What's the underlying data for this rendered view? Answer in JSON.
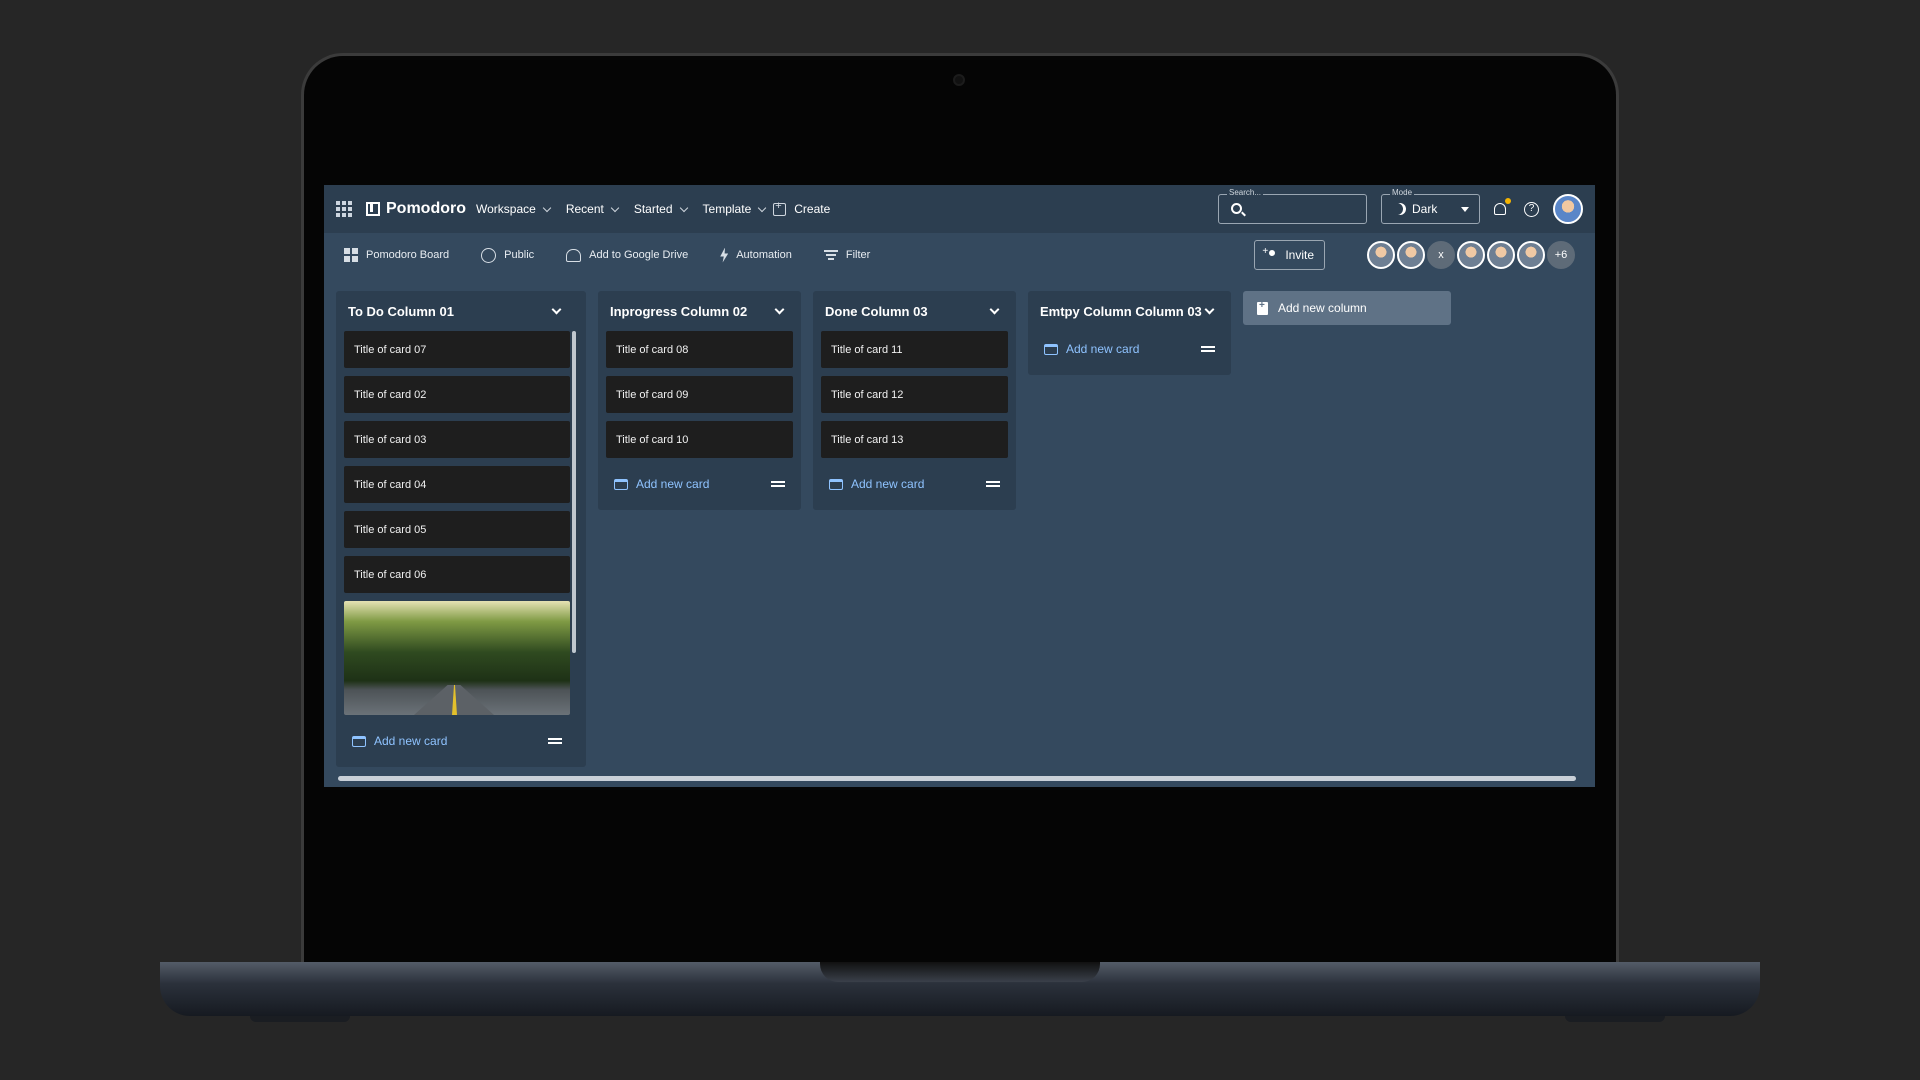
{
  "app": {
    "brand": "Pomodoro",
    "nav": [
      {
        "label": "Workspace"
      },
      {
        "label": "Recent"
      },
      {
        "label": "Started"
      },
      {
        "label": "Template"
      }
    ],
    "create_label": "Create",
    "search_label": "Search...",
    "search_value": "",
    "mode_label": "Mode",
    "mode_value": "Dark"
  },
  "toolbar": {
    "board_label": "Pomodoro Board",
    "public_label": "Public",
    "drive_label": "Add to Google Drive",
    "automation_label": "Automation",
    "filter_label": "Filter",
    "invite_label": "Invite",
    "member_letter": "x",
    "members_more": "+6"
  },
  "columns": [
    {
      "title": "To Do Column 01",
      "cards": [
        "Title of card 07",
        "Title of card 02",
        "Title of card 03",
        "Title of card 04",
        "Title of card 05",
        "Title of card 06"
      ],
      "add_label": "Add new card"
    },
    {
      "title": "Inprogress Column 02",
      "cards": [
        "Title of card 08",
        "Title of card 09",
        "Title of card 10"
      ],
      "add_label": "Add new card"
    },
    {
      "title": "Done Column 03",
      "cards": [
        "Title of card 11",
        "Title of card 12",
        "Title of card 13"
      ],
      "add_label": "Add new card"
    },
    {
      "title": "Emtpy Column Column 03",
      "cards": [],
      "add_label": "Add new card"
    }
  ],
  "add_column_label": "Add new column",
  "colors": {
    "accent_link": "#8fc3ff",
    "notification_dot": "#f5b400",
    "board_bg": "#34495e",
    "column_bg": "#2c3e50",
    "card_bg": "#1e1e1e"
  }
}
